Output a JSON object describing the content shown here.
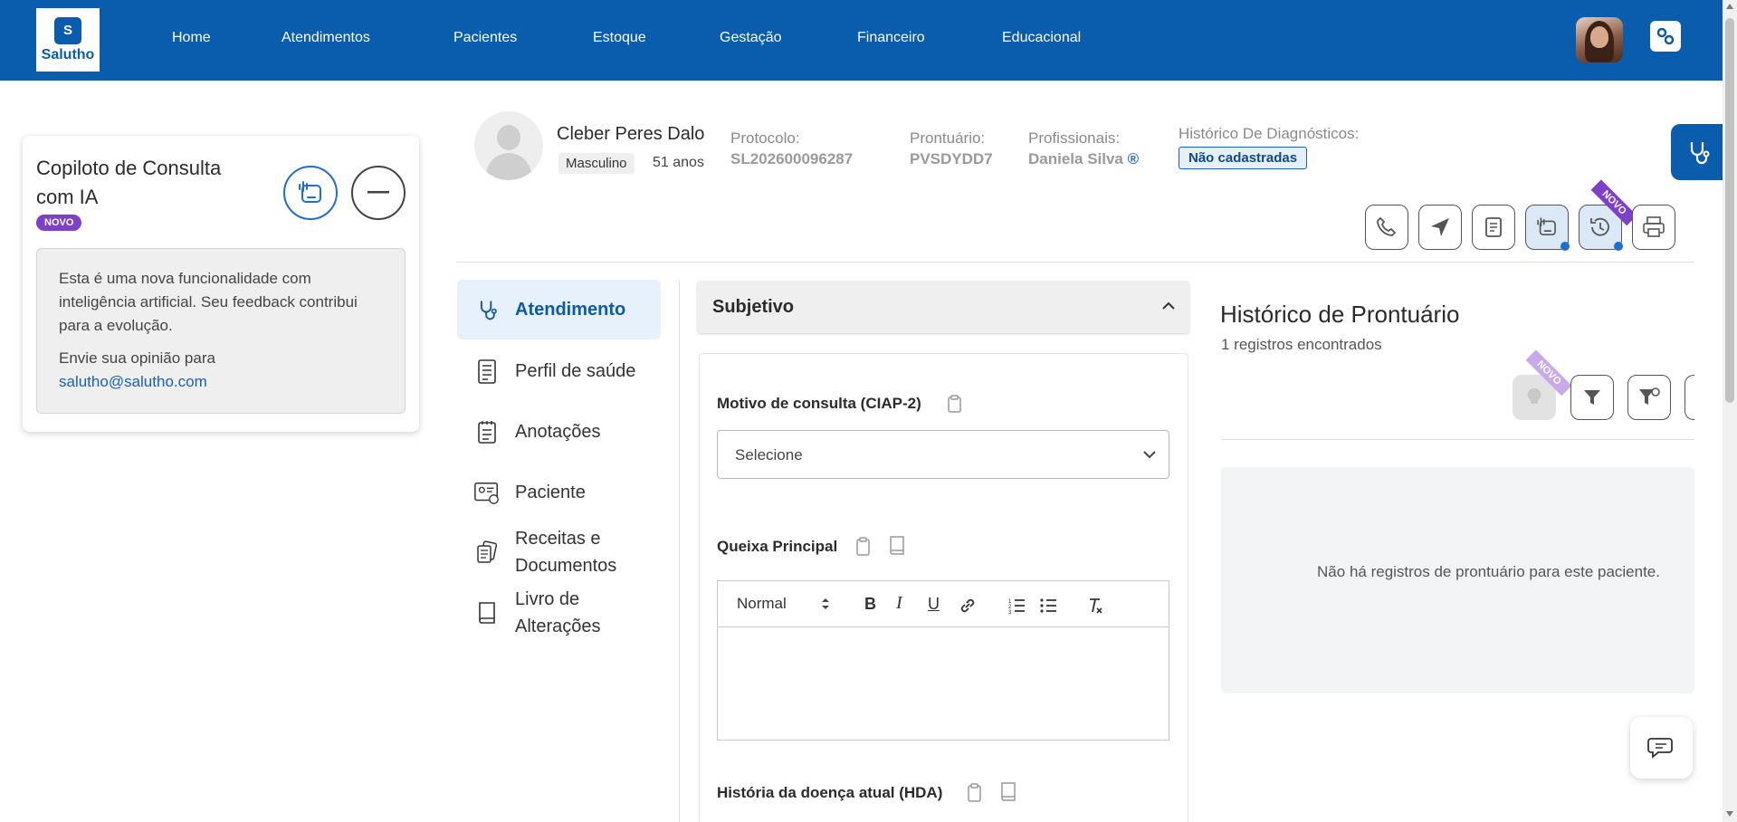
{
  "brand": {
    "logo_text": "Salutho",
    "logo_mark": "S"
  },
  "nav": {
    "items": [
      "Home",
      "Atendimentos",
      "Pacientes",
      "Estoque",
      "Gestação",
      "Financeiro",
      "Educacional"
    ]
  },
  "copilot": {
    "title": "Copiloto de Consulta com IA",
    "badge": "NOVO",
    "message_1": "Esta é uma nova funcionalidade com inteligência artificial. Seu feedback contribui para a evolução.",
    "message_2_prefix": "Envie sua opinião para",
    "email": "salutho@salutho.com"
  },
  "patient": {
    "name": "Cleber Peres Dalo",
    "sex": "Masculino",
    "age": "51 anos",
    "protocol_label": "Protocolo:",
    "protocol_value": "SL202600096287",
    "record_label": "Prontuário:",
    "record_value": "PVSDYDD7",
    "professionals_label": "Profissionais:",
    "professionals_value": "Daniela Silva",
    "professionals_mark": "®",
    "diagnoses_label": "Histórico De Diagnósticos:",
    "diagnoses_value": "Não cadastradas"
  },
  "actions": {
    "ribbon": "NOVO"
  },
  "menu": {
    "items": [
      {
        "label": "Atendimento",
        "icon": "stethoscope-icon"
      },
      {
        "label": "Perfil de saúde",
        "icon": "health-profile-icon"
      },
      {
        "label": "Anotações",
        "icon": "notes-icon"
      },
      {
        "label": "Paciente",
        "icon": "patient-card-icon"
      },
      {
        "label_1": "Receitas e",
        "label_2": "Documentos",
        "icon": "documents-icon"
      },
      {
        "label_1": "Livro de",
        "label_2": "Alterações",
        "icon": "book-icon"
      }
    ]
  },
  "subjective": {
    "title": "Subjetivo",
    "reason_label": "Motivo de consulta (CIAP-2)",
    "reason_placeholder": "Selecione",
    "complaint_label": "Queixa Principal",
    "format_select": "Normal",
    "hda_label": "História da doença atual (HDA)"
  },
  "history": {
    "title": "Histórico de Prontuário",
    "count": "1 registros encontrados",
    "ribbon": "NOVO",
    "empty_text": "Não há registros de prontuário para este paciente."
  },
  "colors": {
    "primary": "#0a5cad",
    "accent_purple": "#7e3fc9",
    "link": "#1a5fb8"
  }
}
